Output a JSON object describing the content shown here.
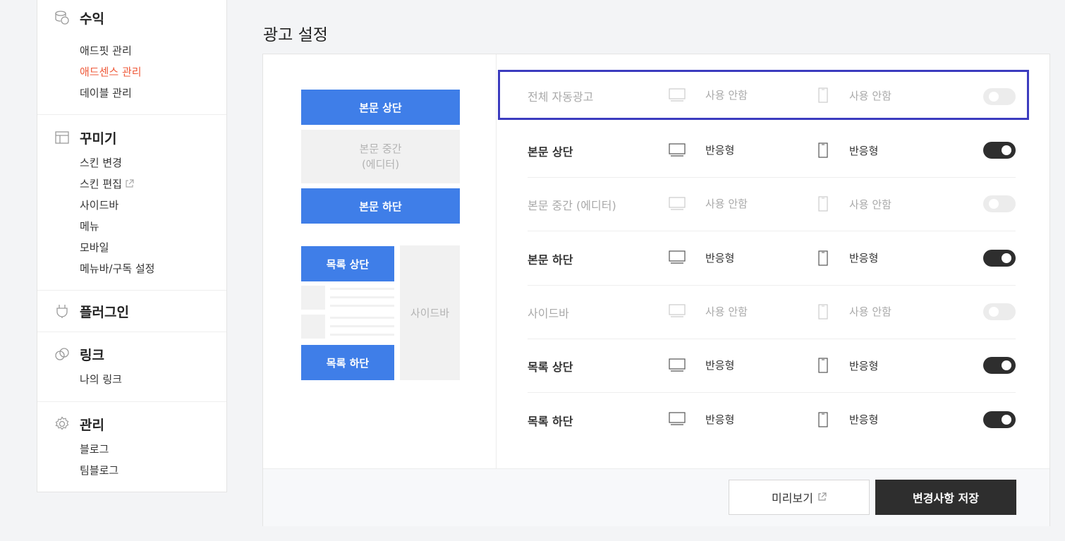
{
  "sidebar": {
    "sections": [
      {
        "title": "수익",
        "icon": "coins-icon",
        "items": [
          "애드핏 관리",
          "애드센스 관리",
          "데이블 관리"
        ],
        "active_index": 1
      },
      {
        "title": "꾸미기",
        "icon": "layout-icon",
        "items": [
          "스킨 변경",
          "스킨 편집",
          "사이드바",
          "메뉴",
          "모바일",
          "메뉴바/구독 설정"
        ]
      },
      {
        "title": "플러그인",
        "icon": "plug-icon",
        "items": []
      },
      {
        "title": "링크",
        "icon": "link-icon",
        "items": [
          "나의 링크"
        ]
      },
      {
        "title": "관리",
        "icon": "gear-icon",
        "items": [
          "블로그",
          "팀블로그"
        ]
      }
    ]
  },
  "main": {
    "title": "광고 설정",
    "preview": {
      "top": "본문 상단",
      "middle_line1": "본문 중간",
      "middle_line2": "(에디터)",
      "bottom": "본문 하단",
      "list_top": "목록 상단",
      "list_bottom": "목록 하단",
      "sidebar": "사이드바"
    },
    "rows": [
      {
        "name": "전체 자동광고",
        "pc": "사용 안함",
        "mobile": "사용 안함",
        "enabled": false
      },
      {
        "name": "본문 상단",
        "pc": "반응형",
        "mobile": "반응형",
        "enabled": true
      },
      {
        "name": "본문 중간 (에디터)",
        "pc": "사용 안함",
        "mobile": "사용 안함",
        "enabled": false
      },
      {
        "name": "본문 하단",
        "pc": "반응형",
        "mobile": "반응형",
        "enabled": true
      },
      {
        "name": "사이드바",
        "pc": "사용 안함",
        "mobile": "사용 안함",
        "enabled": false
      },
      {
        "name": "목록 상단",
        "pc": "반응형",
        "mobile": "반응형",
        "enabled": true
      },
      {
        "name": "목록 하단",
        "pc": "반응형",
        "mobile": "반응형",
        "enabled": true
      }
    ],
    "buttons": {
      "preview": "미리보기",
      "save": "변경사항 저장"
    }
  },
  "colors": {
    "accent_blue": "#3f7ee8",
    "active_menu": "#ef5a3a",
    "dark": "#2e2e2e",
    "highlight": "#3c3cbf"
  }
}
